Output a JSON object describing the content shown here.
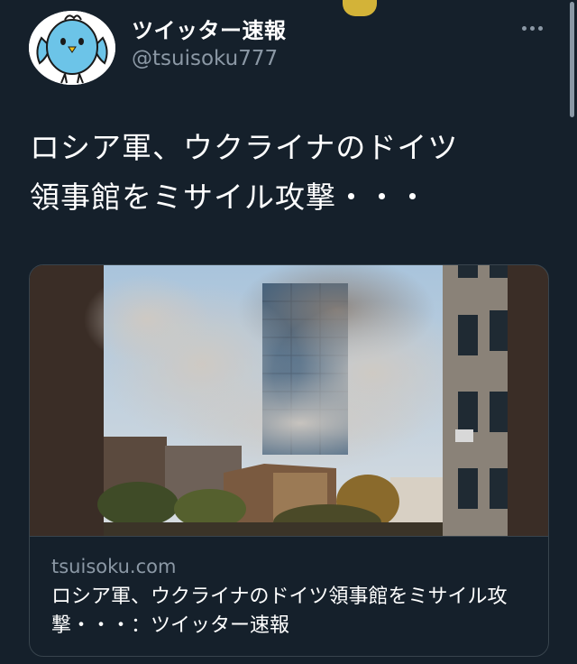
{
  "account": {
    "display_name": "ツイッター速報",
    "handle": "@tsuisoku777"
  },
  "tweet": {
    "text_line1": "ロシア軍、ウクライナのドイツ",
    "text_line2": "領事館をミサイル攻撃・・・"
  },
  "card": {
    "domain": "tsuisoku.com",
    "title": "ロシア軍、ウクライナのドイツ領事館をミサイル攻撃・・・：ツイッター速報"
  },
  "icons": {
    "avatar": "blue-bird-illustration",
    "more": "more-horizontal-icon"
  },
  "colors": {
    "background": "#15202b",
    "text": "#ffffff",
    "secondary_text": "#8b98a5",
    "border": "#38444d"
  }
}
